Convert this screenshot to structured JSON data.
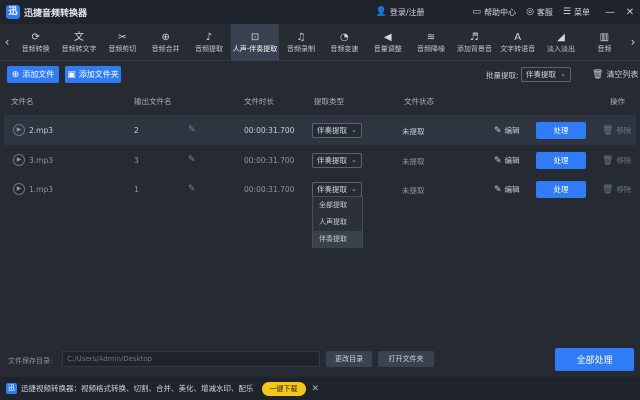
{
  "app": {
    "logo_glyph": "迅",
    "title": "迅捷音频转换器"
  },
  "titlebar": {
    "login": "登录/注册",
    "help": "帮助中心",
    "service": "客服",
    "menu": "菜单",
    "minimize": "—",
    "close": "✕"
  },
  "toolbar": {
    "tools": [
      {
        "label": "音频转换",
        "icon": "convert-icon",
        "glyph": "⟳"
      },
      {
        "label": "音频转文字",
        "icon": "text-icon",
        "glyph": "文"
      },
      {
        "label": "音频剪切",
        "icon": "scissors-icon",
        "glyph": "✂"
      },
      {
        "label": "音频合并",
        "icon": "merge-icon",
        "glyph": "⊕"
      },
      {
        "label": "音频提取",
        "icon": "extract-icon",
        "glyph": "♪"
      },
      {
        "label": "人声-伴奏提取",
        "icon": "vocal-icon",
        "glyph": "⊡"
      },
      {
        "label": "音频录制",
        "icon": "mic-icon",
        "glyph": "♫"
      },
      {
        "label": "音频变速",
        "icon": "speed-icon",
        "glyph": "◔"
      },
      {
        "label": "音量调整",
        "icon": "volume-icon",
        "glyph": "◀"
      },
      {
        "label": "音频降噪",
        "icon": "denoise-icon",
        "glyph": "≋"
      },
      {
        "label": "添加背景音",
        "icon": "bgm-icon",
        "glyph": "♬"
      },
      {
        "label": "文字转语音",
        "icon": "tts-icon",
        "glyph": "A"
      },
      {
        "label": "淡入淡出",
        "icon": "fade-icon",
        "glyph": "◢"
      },
      {
        "label": "音频",
        "icon": "audio-icon",
        "glyph": "▥"
      }
    ],
    "active_index": 5
  },
  "actions": {
    "add_file": "添加文件",
    "add_folder": "添加文件夹",
    "batch_label": "批量提取:",
    "batch_value": "伴奏提取",
    "clear_list": "清空列表"
  },
  "table": {
    "headers": {
      "filename": "文件名",
      "output": "输出文件名",
      "duration": "文件时长",
      "type": "提取类型",
      "status": "文件状态",
      "ops": "操作"
    },
    "rows": [
      {
        "filename": "2.mp3",
        "output": "2",
        "duration": "00:00:31.700",
        "type": "伴奏提取",
        "status": "未提取",
        "edit": "编辑",
        "process": "处理",
        "remove": "移除"
      },
      {
        "filename": "3.mp3",
        "output": "3",
        "duration": "00:00:31.700",
        "type": "伴奏提取",
        "status": "未提取",
        "edit": "编辑",
        "process": "处理",
        "remove": "移除"
      },
      {
        "filename": "1.mp3",
        "output": "1",
        "duration": "00:00:31.700",
        "type": "伴奏提取",
        "status": "未提取",
        "edit": "编辑",
        "process": "处理",
        "remove": "移除"
      }
    ]
  },
  "dropdown": {
    "options": [
      "全部提取",
      "人声提取",
      "伴奏提取"
    ],
    "selected_index": 2
  },
  "bottom": {
    "save_label": "文件保存目录:",
    "save_path": "C:/Users/Admin/Desktop",
    "change_dir": "更改目录",
    "open_folder": "打开文件夹",
    "process_all": "全部处理"
  },
  "ad": {
    "logo_glyph": "迅",
    "text": "迅捷视频转换器：视频格式转换、切割、合并、美化、增减水印、配乐",
    "download": "一键下载",
    "close": "✕"
  },
  "colors": {
    "accent": "#2f7cf6",
    "background": "#252a33",
    "ad_button": "#f5c518"
  }
}
